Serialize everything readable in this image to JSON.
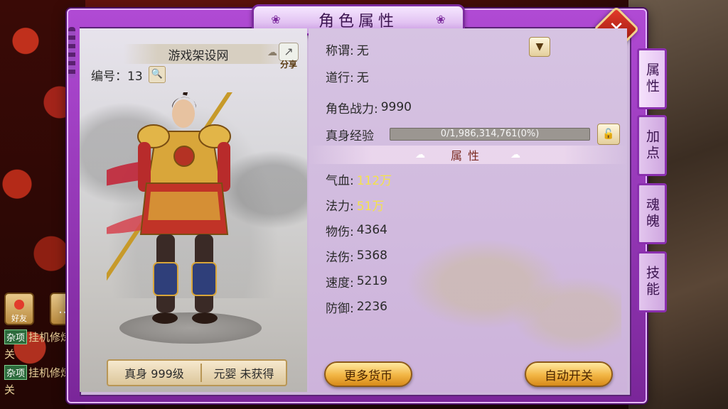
{
  "window": {
    "title": "角色属性",
    "close_label": "✕"
  },
  "character": {
    "name": "游戏架设网",
    "id_label": "编号：13",
    "share_label": "分享",
    "real_body_label": "真身 999级",
    "nascent_soul_label": "元婴 未获得"
  },
  "info": {
    "title_label": "称谓:",
    "title_value": "无",
    "dao_label": "道行:",
    "dao_value": "无",
    "power_label": "角色战力:",
    "power_value": "9990",
    "exp_label": "真身经验",
    "exp_value": "0/1,986,314,761(0%)",
    "exp_fraction": 0
  },
  "attributes": {
    "header": "属性",
    "rows": [
      {
        "label": "气血:",
        "value": "112万"
      },
      {
        "label": "法力:",
        "value": "51万"
      },
      {
        "label": "物伤:",
        "value": "4364"
      },
      {
        "label": "法伤:",
        "value": "5368"
      },
      {
        "label": "速度:",
        "value": "5219"
      },
      {
        "label": "防御:",
        "value": "2236"
      }
    ]
  },
  "buttons": {
    "more_currency": "更多货币",
    "auto_toggle": "自动开关"
  },
  "tabs": [
    {
      "label": "属性",
      "active": true
    },
    {
      "label": "加点",
      "active": false
    },
    {
      "label": "魂魄",
      "active": false
    },
    {
      "label": "技能",
      "active": false
    }
  ],
  "chat": {
    "friends_label": "好友",
    "lines": [
      {
        "tag": "杂项",
        "text": "挂机修炼"
      },
      {
        "tag": "",
        "text": "关"
      },
      {
        "tag": "杂项",
        "text": "挂机修炼"
      },
      {
        "tag": "",
        "text": "关"
      }
    ]
  },
  "colors": {
    "frame": "#9b3cc2",
    "gold_button": "#f2b543",
    "highlight_value": "#f4e24a"
  },
  "icons": {
    "close": "close-icon",
    "share": "share-icon",
    "search": "search-icon",
    "dropdown": "chevron-down-icon",
    "lock": "lock-icon"
  }
}
